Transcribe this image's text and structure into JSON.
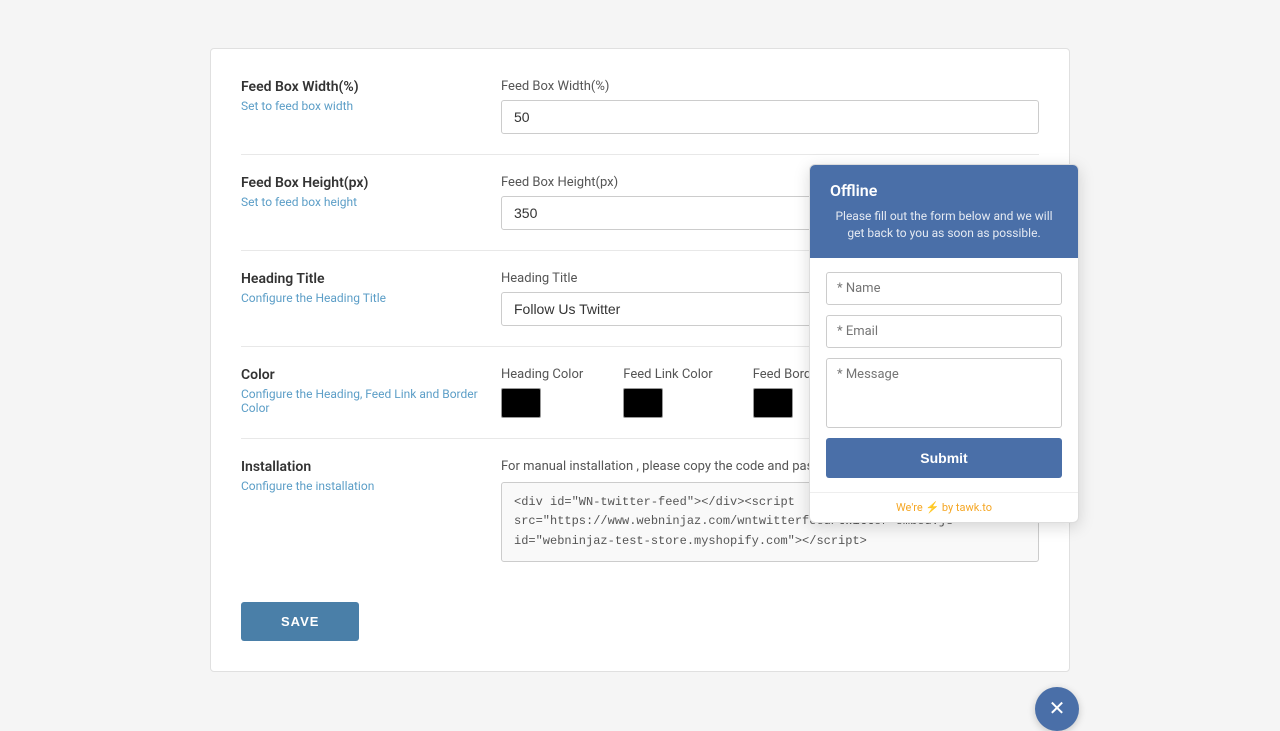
{
  "page": {
    "background": "#f5f5f5"
  },
  "form": {
    "sections": {
      "feedBoxWidth": {
        "label": "Feed Box Width(%)",
        "description": "Set to feed box width",
        "fieldLabel": "Feed Box Width(%)",
        "value": "50"
      },
      "feedBoxHeight": {
        "label": "Feed Box Height(px)",
        "description": "Set to feed box height",
        "fieldLabel": "Feed Box Height(px)",
        "value": "350"
      },
      "headingTitle": {
        "label": "Heading Title",
        "description": "Configure the Heading Title",
        "fieldLabel": "Heading Title",
        "value": "Follow Us Twitter"
      },
      "color": {
        "label": "Color",
        "description": "Configure the Heading, Feed Link and Border Color",
        "headingColorLabel": "Heading Color",
        "feedLinkColorLabel": "Feed Link Color",
        "feedBorderColorLabel": "Feed Border Color"
      },
      "installation": {
        "label": "Installation",
        "description": "Configure the installation",
        "note": "For manual installation , please copy the code and paste in your them",
        "code": "<div id=\"WN-twitter-feed\"></div><script\nsrc=\"https://www.webninjaz.com/wntwitterfeed/twitter-embed.js\"\nid=\"webninjaz-test-store.myshopify.com\"></script>"
      }
    },
    "saveButton": "SAVE"
  },
  "chat": {
    "status": "Offline",
    "description": "Please fill out the form below and we will get back to you as soon as possible.",
    "namePlaceholder": "* Name",
    "emailPlaceholder": "* Email",
    "messagePlaceholder": "* Message",
    "submitLabel": "Submit",
    "footerText": "We're",
    "footerBrand": "⚡",
    "footerSuffix": " by tawk.to"
  }
}
